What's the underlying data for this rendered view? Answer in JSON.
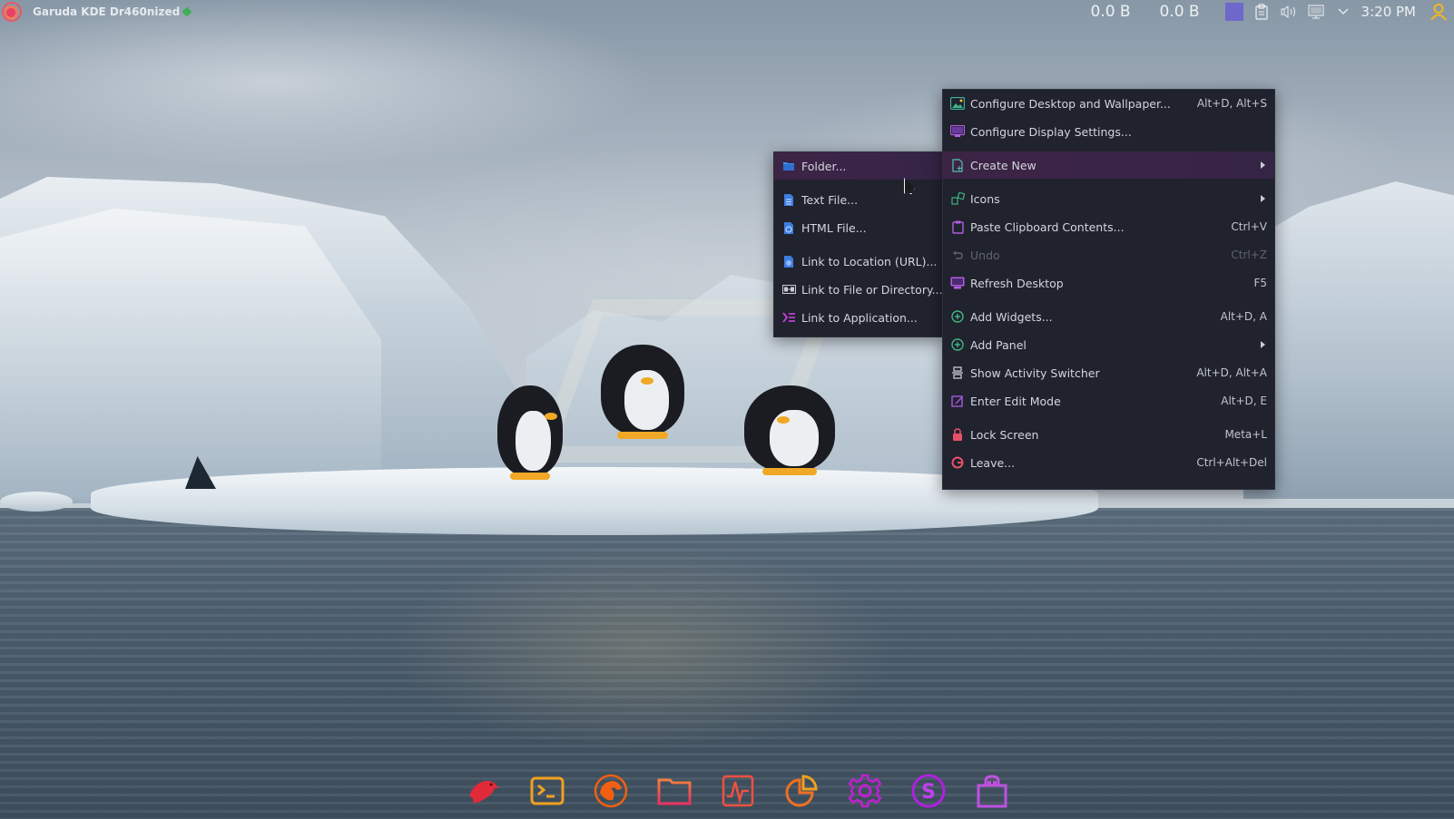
{
  "top_panel": {
    "window_title": "Garuda KDE Dr460nized",
    "launcher_icon": "garuda-logo-icon",
    "net_download": "0.0 B",
    "net_upload": "0.0 B",
    "tray_icons": [
      "virtual-desktop-pager-icon",
      "clipboard-icon",
      "volume-icon",
      "network-icon",
      "expand-tray-chevron-icon"
    ],
    "clock": "3:20 PM",
    "user_icon": "user-icon"
  },
  "context_menu": {
    "items": [
      {
        "label": "Configure Desktop and Wallpaper...",
        "shortcut": "Alt+D, Alt+S",
        "icon": "wallpaper-icon",
        "color": "#3fb6a0"
      },
      {
        "label": "Configure Display Settings...",
        "shortcut": "",
        "icon": "display-icon",
        "color": "#b15fe0"
      },
      {
        "label": "Create New",
        "shortcut": "",
        "icon": "new-file-icon",
        "color": "#4fc3b0",
        "submenu": true,
        "highlighted": true
      },
      {
        "label": "Icons",
        "shortcut": "",
        "icon": "icons-icon",
        "color": "#3fb680",
        "submenu": true
      },
      {
        "label": "Paste Clipboard Contents...",
        "shortcut": "Ctrl+V",
        "icon": "paste-icon",
        "color": "#b15fe0"
      },
      {
        "label": "Undo",
        "shortcut": "Ctrl+Z",
        "icon": "undo-icon",
        "color": "#5f6372",
        "disabled": true
      },
      {
        "label": "Refresh Desktop",
        "shortcut": "F5",
        "icon": "refresh-desktop-icon",
        "color": "#b15fe0"
      },
      {
        "label": "Add Widgets...",
        "shortcut": "Alt+D, A",
        "icon": "add-icon",
        "color": "#3fb680"
      },
      {
        "label": "Add Panel",
        "shortcut": "",
        "icon": "add-icon",
        "color": "#3fb680",
        "submenu": true
      },
      {
        "label": "Show Activity Switcher",
        "shortcut": "Alt+D, Alt+A",
        "icon": "activities-icon",
        "color": "#c8ccd4"
      },
      {
        "label": "Enter Edit Mode",
        "shortcut": "Alt+D, E",
        "icon": "edit-icon",
        "color": "#a858e0"
      },
      {
        "label": "Lock Screen",
        "shortcut": "Meta+L",
        "icon": "lock-icon",
        "color": "#e8506a"
      },
      {
        "label": "Leave...",
        "shortcut": "Ctrl+Alt+Del",
        "icon": "leave-icon",
        "color": "#e8506a"
      }
    ]
  },
  "create_new_submenu": {
    "items": [
      {
        "label": "Folder...",
        "icon": "folder-icon",
        "color": "#3d8ef0",
        "highlighted": true
      },
      {
        "label": "Text File...",
        "icon": "text-file-icon",
        "color": "#3d8ef0"
      },
      {
        "label": "HTML File...",
        "icon": "html-file-icon",
        "color": "#3d8ef0"
      },
      {
        "label": "Link to Location (URL)...",
        "icon": "url-link-icon",
        "color": "#3d8ef0"
      },
      {
        "label": "Link to File or Directory...",
        "icon": "file-link-icon",
        "color": "#c8ccd4"
      },
      {
        "label": "Link to Application...",
        "icon": "app-link-icon",
        "color": "#d040e0"
      }
    ]
  },
  "dock": {
    "items": [
      {
        "name": "garuda-welcome",
        "icon": "eagle-icon",
        "color": "#e02a3a"
      },
      {
        "name": "terminal",
        "icon": "terminal-icon",
        "color": "#f0a020"
      },
      {
        "name": "firedragon-browser",
        "icon": "dragon-icon",
        "color": "#f06010"
      },
      {
        "name": "file-manager",
        "icon": "folder-icon",
        "color": "#f05a40"
      },
      {
        "name": "system-monitor",
        "icon": "activity-monitor-icon",
        "color": "#f05040"
      },
      {
        "name": "disk-usage",
        "icon": "pie-chart-icon",
        "color": "#f07020"
      },
      {
        "name": "system-settings",
        "icon": "gear-icon",
        "color": "#c020d0"
      },
      {
        "name": "software-center",
        "icon": "s-circle-icon",
        "color": "#b020e0"
      },
      {
        "name": "package-store",
        "icon": "shopping-bag-icon",
        "color": "#c050e0"
      }
    ]
  }
}
